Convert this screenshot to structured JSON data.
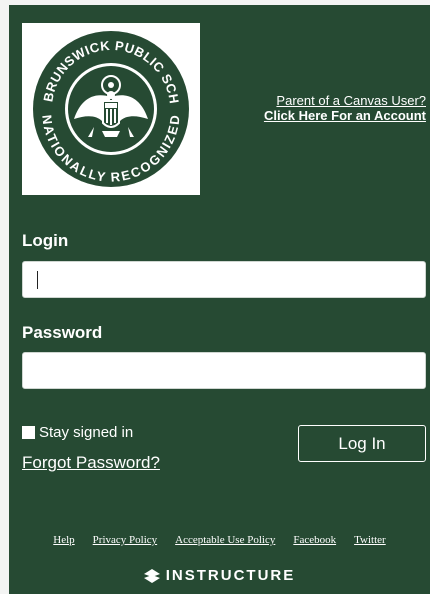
{
  "logo": {
    "ring_top": "EAST BRUNSWICK PUBLIC SCHOOLS",
    "ring_bottom": "NATIONALLY RECOGNIZED"
  },
  "parent_links": {
    "line1": "Parent of a Canvas User?",
    "line2": "Click Here For an Account"
  },
  "login": {
    "label": "Login",
    "value": ""
  },
  "password": {
    "label": "Password",
    "value": ""
  },
  "remember": {
    "label": "Stay signed in"
  },
  "forgot": {
    "label": "Forgot Password?"
  },
  "login_button": {
    "label": "Log In"
  },
  "footer": {
    "links": [
      "Help",
      "Privacy Policy",
      "Acceptable Use Policy",
      "Facebook",
      "Twitter"
    ]
  },
  "brand": {
    "name": "INSTRUCTURE",
    "icon": "instructure-logo-icon"
  },
  "colors": {
    "panel": "#264a33",
    "text": "#ffffff"
  }
}
